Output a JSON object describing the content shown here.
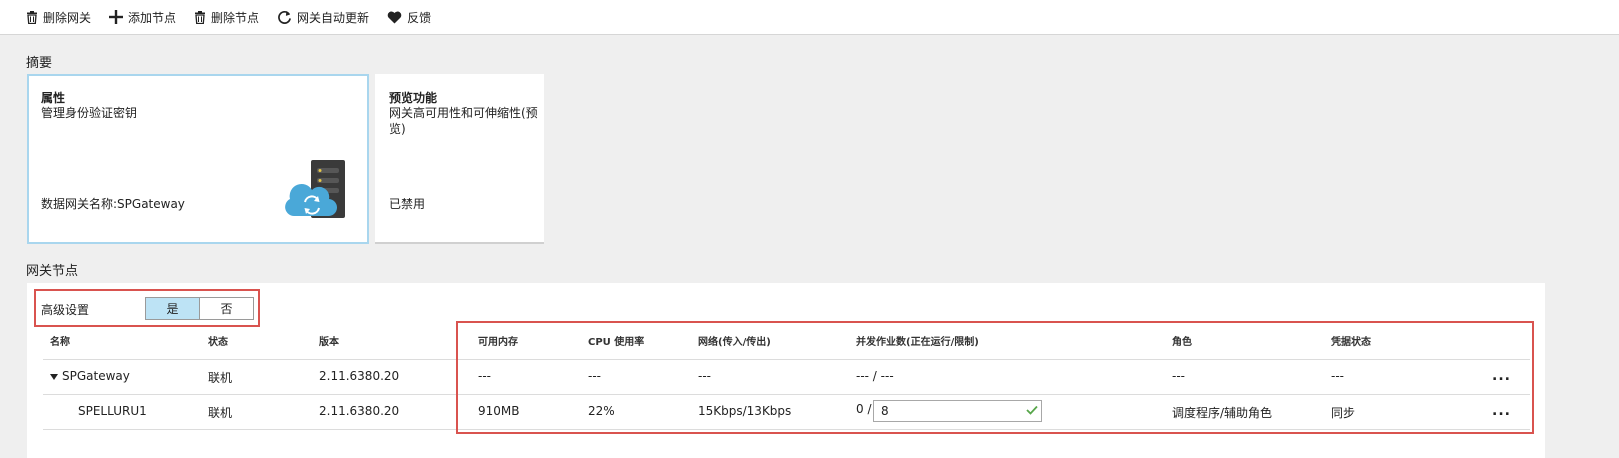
{
  "toolbar": {
    "items": [
      {
        "label": "删除网关",
        "icon": "trash-icon"
      },
      {
        "label": "添加节点",
        "icon": "plus-icon"
      },
      {
        "label": "删除节点",
        "icon": "trash-icon"
      },
      {
        "label": "网关自动更新",
        "icon": "refresh-icon"
      },
      {
        "label": "反馈",
        "icon": "heart-icon"
      }
    ]
  },
  "summary": {
    "title": "摘要",
    "properties_tile": {
      "title": "属性",
      "subtitle": "管理身份验证密钥",
      "bottom": "数据网关名称:SPGateway",
      "icon": "gateway-server-cloud-icon"
    },
    "preview_tile": {
      "title": "预览功能",
      "subtitle": "网关高可用性和可伸缩性(预览)",
      "bottom": "已禁用"
    }
  },
  "nodes": {
    "title": "网关节点",
    "advanced": {
      "label": "高级设置",
      "yes": "是",
      "no": "否",
      "selected": "是"
    },
    "columns": [
      "名称",
      "状态",
      "版本",
      "可用内存",
      "CPU 使用率",
      "网络(传入/传出)",
      "并发作业数(正在运行/限制)",
      "角色",
      "凭据状态"
    ],
    "rows": [
      {
        "name": "SPGateway",
        "expanded": true,
        "status": "联机",
        "version": "2.11.6380.20",
        "memory": "---",
        "cpu": "---",
        "network": "---",
        "jobs": "--- / ---",
        "role": "---",
        "credential": "---",
        "more": "..."
      },
      {
        "name": "SPELLURU1",
        "status": "联机",
        "version": "2.11.6380.20",
        "memory": "910MB",
        "cpu": "22%",
        "network": "15Kbps/13Kbps",
        "jobs_running": "0 /",
        "jobs_limit": "8",
        "role": "调度程序/辅助角色",
        "credential": "同步",
        "more": "..."
      }
    ]
  },
  "colors": {
    "accent_blue": "#4aa8d8",
    "toggle_selected": "#bde3f5",
    "highlight_red": "#d9534f",
    "check_green": "#57a64a"
  }
}
